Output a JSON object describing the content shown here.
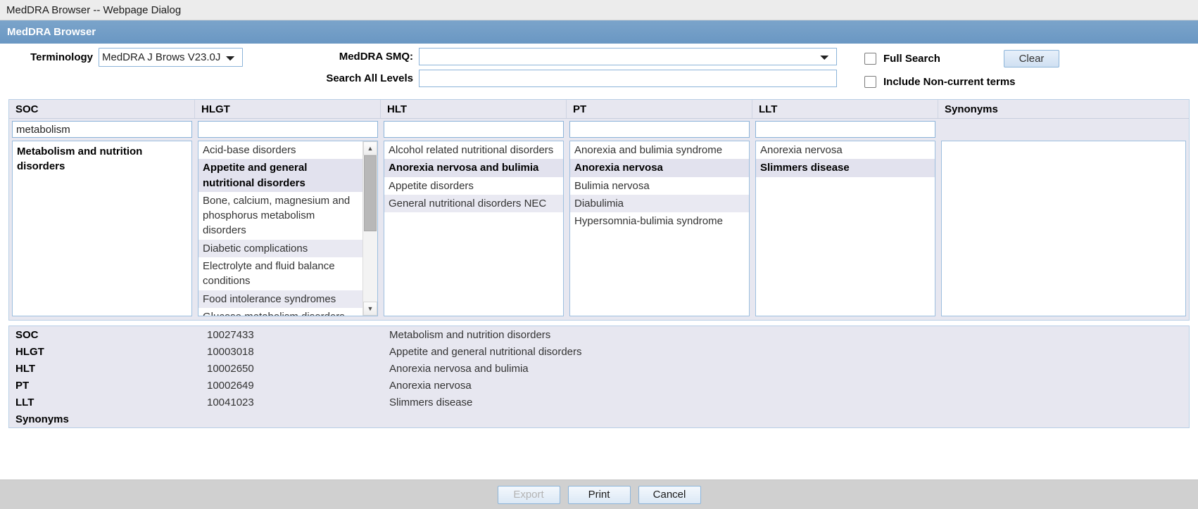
{
  "window": {
    "title": "MedDRA Browser -- Webpage Dialog"
  },
  "header": {
    "title": "MedDRA Browser",
    "accent_color": "#6e9bc5"
  },
  "search": {
    "terminology_label": "Terminology",
    "terminology_value": "MedDRA J Brows V23.0J",
    "terminology_options": [
      "MedDRA J Brows V23.0J"
    ],
    "smq_label": "MedDRA SMQ:",
    "smq_value": "",
    "smq_placeholder": "",
    "search_all_levels_label": "Search All Levels",
    "search_all_levels_value": "",
    "full_search_label": "Full Search",
    "full_search_checked": false,
    "include_noncurrent_label": "Include Non-current terms",
    "include_noncurrent_checked": false,
    "clear_label": "Clear"
  },
  "grid": {
    "columns": [
      {
        "key": "soc",
        "header": "SOC"
      },
      {
        "key": "hlgt",
        "header": "HLGT"
      },
      {
        "key": "hlt",
        "header": "HLT"
      },
      {
        "key": "pt",
        "header": "PT"
      },
      {
        "key": "llt",
        "header": "LLT"
      },
      {
        "key": "syn",
        "header": "Synonyms"
      }
    ],
    "filters": {
      "soc": "metabolism",
      "hlgt": "",
      "hlt": "",
      "pt": "",
      "llt": ""
    },
    "soc_items": [
      {
        "label": "Metabolism and nutrition disorders",
        "selected": true
      }
    ],
    "hlgt_items": [
      {
        "label": "Acid-base disorders",
        "selected": false
      },
      {
        "label": "Appetite and general nutritional disorders",
        "selected": true
      },
      {
        "label": "Bone, calcium, magnesium and phosphorus metabolism disorders",
        "selected": false
      },
      {
        "label": "Diabetic complications",
        "selected": false
      },
      {
        "label": "Electrolyte and fluid balance conditions",
        "selected": false
      },
      {
        "label": "Food intolerance syndromes",
        "selected": false
      },
      {
        "label": "Glucose metabolism disorders (incl diabetes mellitus)",
        "selected": false
      }
    ],
    "hlgt_scroll": {
      "has_scrollbar": true,
      "up_arrow": "▲",
      "down_arrow": "▼"
    },
    "hlt_items": [
      {
        "label": "Alcohol related nutritional disorders",
        "selected": false
      },
      {
        "label": "Anorexia nervosa and bulimia",
        "selected": true
      },
      {
        "label": "Appetite disorders",
        "selected": false
      },
      {
        "label": "General nutritional disorders NEC",
        "selected": false
      }
    ],
    "pt_items": [
      {
        "label": "Anorexia and bulimia syndrome",
        "selected": false
      },
      {
        "label": "Anorexia nervosa",
        "selected": true
      },
      {
        "label": "Bulimia nervosa",
        "selected": false
      },
      {
        "label": "Diabulimia",
        "selected": false
      },
      {
        "label": "Hypersomnia-bulimia syndrome",
        "selected": false
      }
    ],
    "llt_items": [
      {
        "label": "Anorexia nervosa",
        "selected": false
      },
      {
        "label": "Slimmers disease",
        "selected": true
      }
    ],
    "syn_items": []
  },
  "detail": {
    "rows": [
      {
        "level": "SOC",
        "code": "10027433",
        "name": "Metabolism and nutrition disorders"
      },
      {
        "level": "HLGT",
        "code": "10003018",
        "name": "Appetite and general nutritional disorders"
      },
      {
        "level": "HLT",
        "code": "10002650",
        "name": "Anorexia nervosa and bulimia"
      },
      {
        "level": "PT",
        "code": "10002649",
        "name": "Anorexia nervosa"
      },
      {
        "level": "LLT",
        "code": "10041023",
        "name": "Slimmers disease"
      },
      {
        "level": "Synonyms",
        "code": "",
        "name": ""
      }
    ]
  },
  "footer": {
    "export_label": "Export",
    "export_disabled": true,
    "print_label": "Print",
    "cancel_label": "Cancel"
  }
}
